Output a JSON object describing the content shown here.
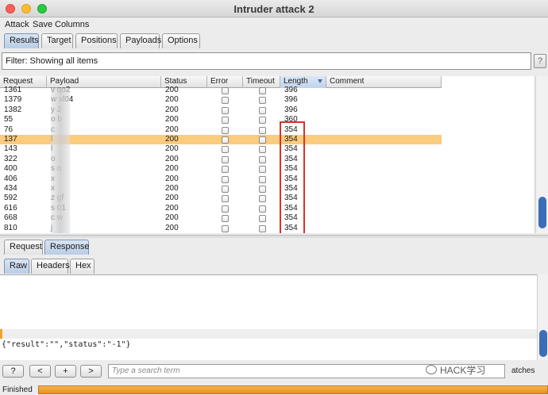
{
  "window": {
    "title": "Intruder attack 2"
  },
  "menu": [
    "Attack",
    "Save",
    "Columns"
  ],
  "top_tabs": [
    "Results",
    "Target",
    "Positions",
    "Payloads",
    "Options"
  ],
  "filter": {
    "text": "Filter: Showing all items",
    "help": "?"
  },
  "columns": [
    "Request",
    "Payload",
    "Status",
    "Error",
    "Timeout",
    "Length",
    "Comment"
  ],
  "sorted_column": "Length",
  "rows": [
    {
      "request": "1361",
      "payload": "v   qo2",
      "status": "200",
      "length": "396",
      "highlight": false
    },
    {
      "request": "1379",
      "payload": "w   xl04",
      "status": "200",
      "length": "396",
      "highlight": false
    },
    {
      "request": "1382",
      "payload": "y   2",
      "status": "200",
      "length": "396",
      "highlight": false
    },
    {
      "request": "55",
      "payload": "o   b",
      "status": "200",
      "length": "360",
      "highlight": false
    },
    {
      "request": "76",
      "payload": "c",
      "status": "200",
      "length": "354",
      "highlight": false
    },
    {
      "request": "137",
      "payload": "l",
      "status": "200",
      "length": "354",
      "highlight": true
    },
    {
      "request": "143",
      "payload": "l",
      "status": "200",
      "length": "354",
      "highlight": false
    },
    {
      "request": "322",
      "payload": "o",
      "status": "200",
      "length": "354",
      "highlight": false
    },
    {
      "request": "400",
      "payload": "s   o",
      "status": "200",
      "length": "354",
      "highlight": false
    },
    {
      "request": "406",
      "payload": "x",
      "status": "200",
      "length": "354",
      "highlight": false
    },
    {
      "request": "434",
      "payload": "x",
      "status": "200",
      "length": "354",
      "highlight": false
    },
    {
      "request": "592",
      "payload": "z   gf",
      "status": "200",
      "length": "354",
      "highlight": false
    },
    {
      "request": "616",
      "payload": "s   01",
      "status": "200",
      "length": "354",
      "highlight": false
    },
    {
      "request": "668",
      "payload": "c   w",
      "status": "200",
      "length": "354",
      "highlight": false
    },
    {
      "request": "810",
      "payload": "j",
      "status": "200",
      "length": "354",
      "highlight": false
    }
  ],
  "detail_tabs": [
    "Request",
    "Response"
  ],
  "view_tabs": [
    "Raw",
    "Headers",
    "Hex"
  ],
  "response_body": "{\"result\":\"\",\"status\":\"-1\"}",
  "search": {
    "help": "?",
    "prev": "<",
    "add": "+",
    "next": ">",
    "placeholder": "Type a search term",
    "matches": "atches"
  },
  "watermark": "HACK学习",
  "status": {
    "text": "Finished",
    "progress": 1.0
  },
  "colors": {
    "highlight_row": "#fbcb7e",
    "accent_box": "#d9332b",
    "progress": "#eb8f19"
  }
}
